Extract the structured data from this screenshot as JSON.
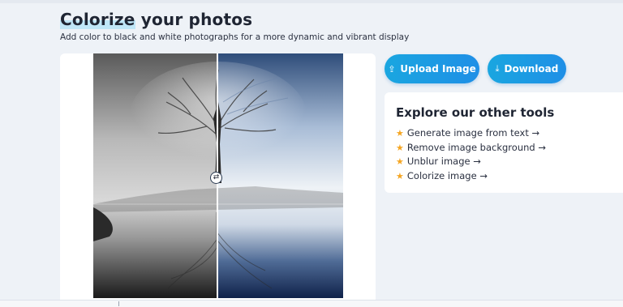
{
  "page": {
    "title_highlight": "Colorize",
    "title_rest": " your photos",
    "subtitle": "Add color to black and white photographs for a more dynamic and vibrant display"
  },
  "actions": {
    "upload_label": "Upload Image",
    "download_label": "Download",
    "upload_icon": "upload-icon",
    "download_icon": "download-icon"
  },
  "compare": {
    "split": 0.5,
    "handle_icon": "compare-arrows-icon",
    "left_label": "black-and-white original",
    "right_label": "colorized result"
  },
  "tools": {
    "title": "Explore our other tools",
    "items": [
      {
        "label": "Generate image from text →"
      },
      {
        "label": "Remove image background →"
      },
      {
        "label": "Unblur image →"
      },
      {
        "label": "Colorize image →"
      }
    ]
  },
  "colors": {
    "accent": "#1aa6e0",
    "star": "#f5a623",
    "background": "#eef2f7"
  }
}
